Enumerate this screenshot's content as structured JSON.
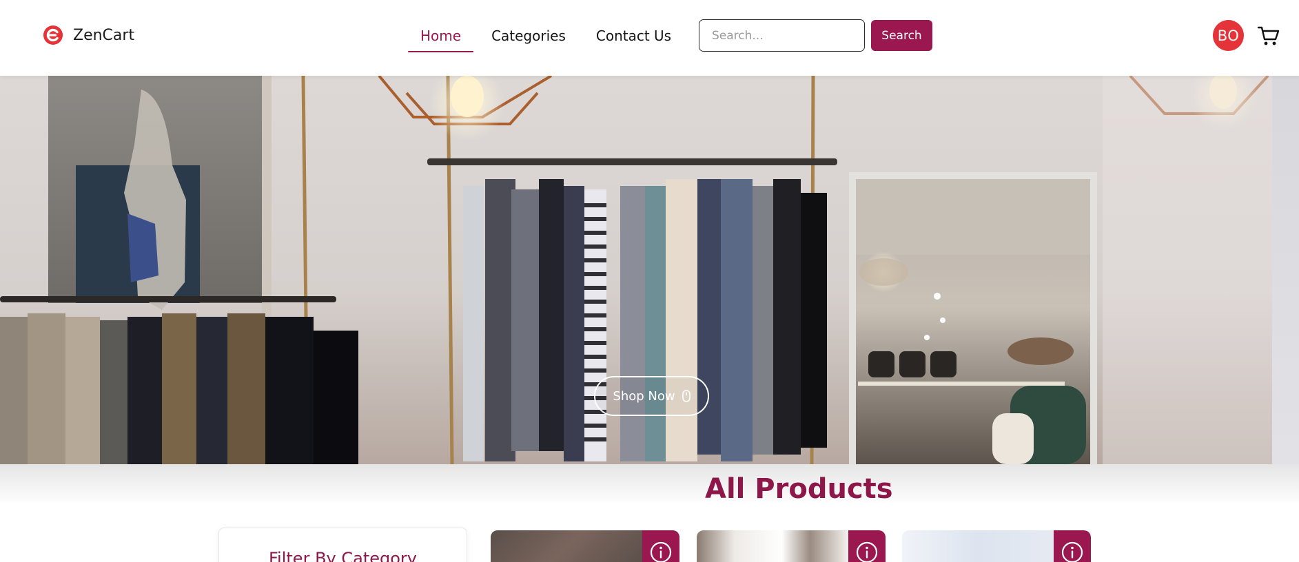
{
  "header": {
    "brand_name": "ZenCart",
    "brand_logo_icon": "zencart-logo-icon",
    "brand_color": "#e5333a",
    "nav": [
      {
        "label": "Home",
        "active": true
      },
      {
        "label": "Categories",
        "active": false
      },
      {
        "label": "Contact Us",
        "active": false
      }
    ],
    "search": {
      "placeholder": "Search...",
      "value": "",
      "button_label": "Search"
    },
    "avatar_initials": "BO",
    "cart_icon": "shopping-cart-icon"
  },
  "hero": {
    "button_label": "Shop Now",
    "button_icon": "mouse-icon"
  },
  "products": {
    "section_title": "All Products",
    "filter_title": "Filter By Category",
    "card_icon": "info-icon"
  },
  "colors": {
    "accent": "#9b174f",
    "avatar_bg": "#e5333a",
    "title": "#8e1749"
  }
}
